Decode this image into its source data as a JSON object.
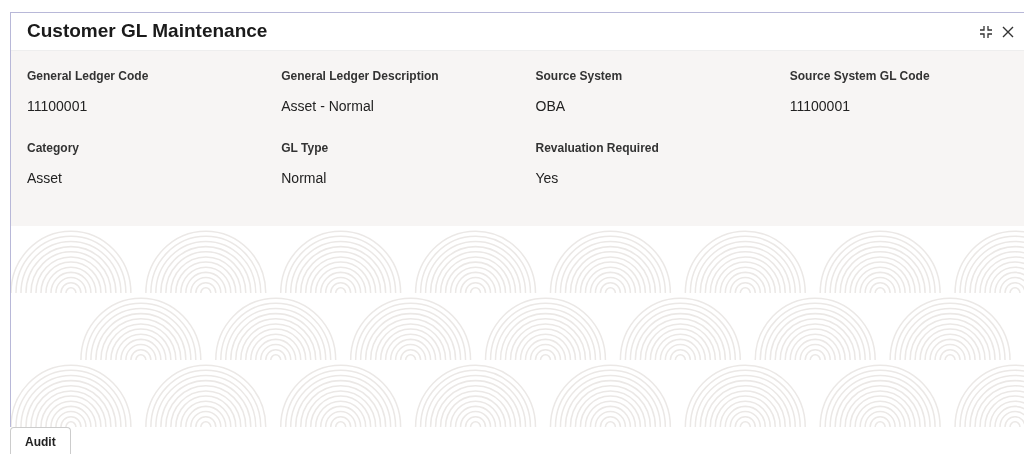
{
  "window": {
    "title": "Customer GL Maintenance"
  },
  "fields": [
    {
      "label": "General Ledger Code",
      "value": "11100001"
    },
    {
      "label": "General Ledger Description",
      "value": "Asset - Normal"
    },
    {
      "label": "Source System",
      "value": "OBA"
    },
    {
      "label": "Source System GL Code",
      "value": "11100001"
    },
    {
      "label": "Category",
      "value": "Asset"
    },
    {
      "label": "GL Type",
      "value": "Normal"
    },
    {
      "label": "Revaluation Required",
      "value": "Yes"
    }
  ],
  "footer": {
    "buttons": [
      "Audit"
    ]
  }
}
